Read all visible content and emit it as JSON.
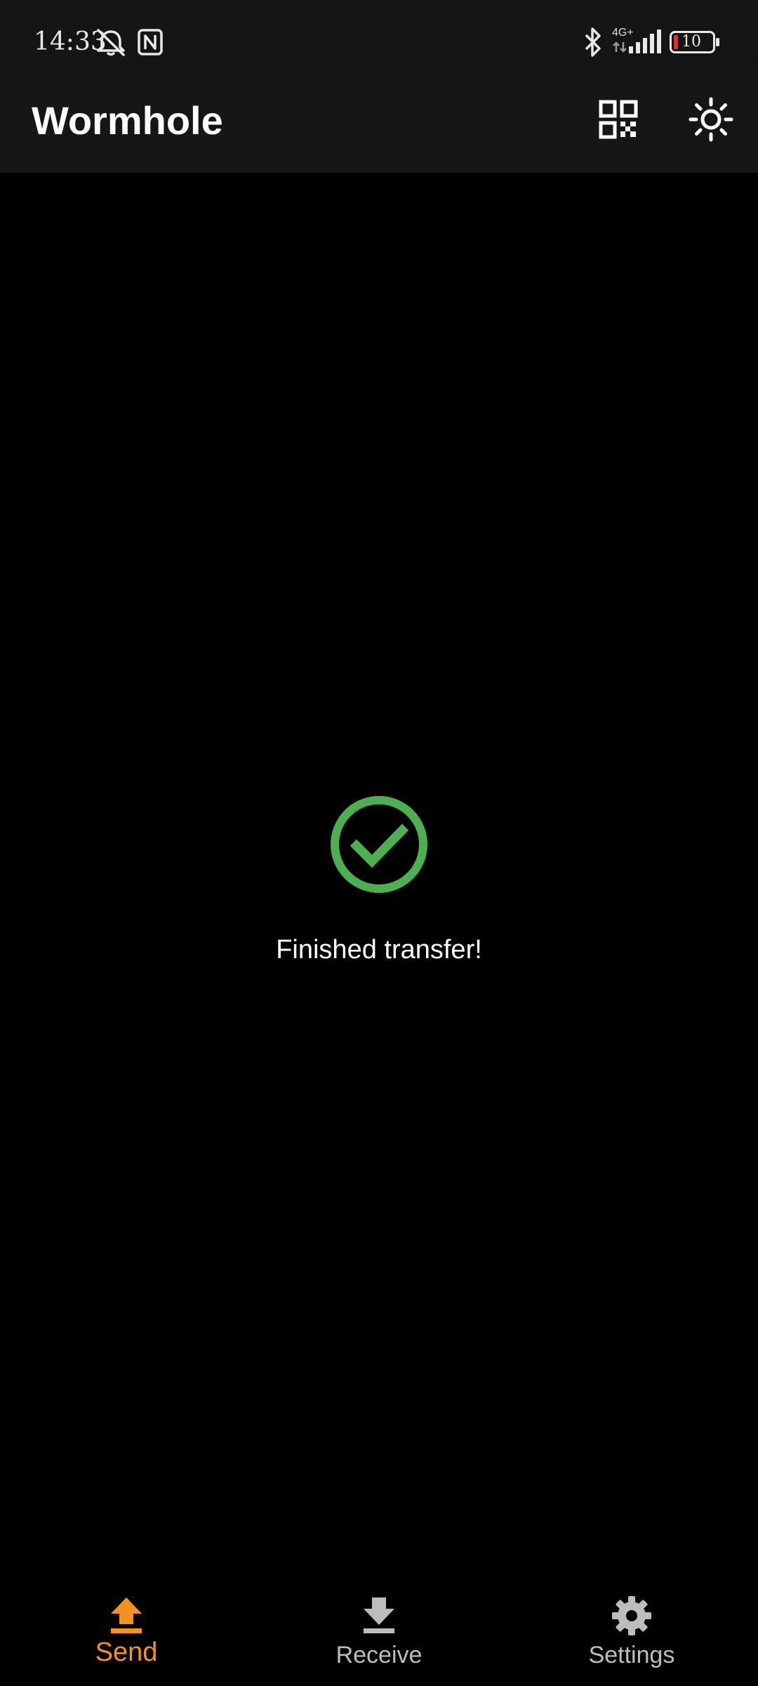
{
  "status_bar": {
    "time": "14:33",
    "network_type": "4G+",
    "battery_level": "10",
    "icons": [
      "muted-bell-icon",
      "nfc-icon",
      "bluetooth-icon",
      "signal-icon",
      "battery-icon"
    ]
  },
  "app_bar": {
    "title": "Wormhole",
    "actions": [
      {
        "name": "qr-code-icon"
      },
      {
        "name": "brightness-icon"
      }
    ]
  },
  "main": {
    "status_icon": "check-circle-icon",
    "message": "Finished transfer!"
  },
  "bottom_nav": {
    "items": [
      {
        "label": "Send",
        "icon": "upload-icon",
        "active": true
      },
      {
        "label": "Receive",
        "icon": "download-icon",
        "active": false
      },
      {
        "label": "Settings",
        "icon": "gear-icon",
        "active": false
      }
    ]
  },
  "colors": {
    "accent": "#f5921e",
    "success": "#4caf50",
    "app_bar_bg": "#161616",
    "status_bar_bg": "#141414",
    "background": "#000000",
    "inactive": "#bdbdbd"
  }
}
